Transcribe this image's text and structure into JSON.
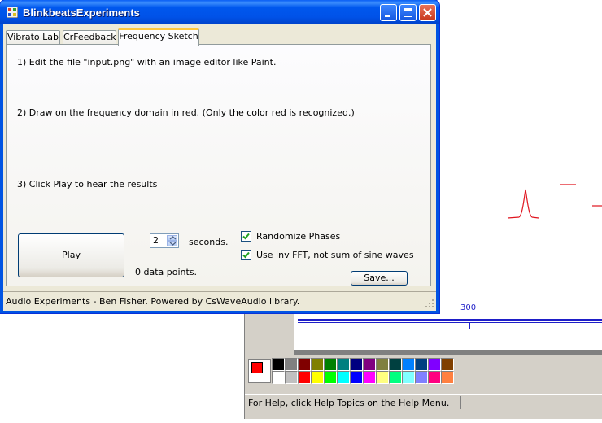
{
  "window": {
    "title": "BlinkbeatsExperiments"
  },
  "tabs": [
    {
      "label": "Vibrato Lab"
    },
    {
      "label": "CrFeedback"
    },
    {
      "label": "Frequency Sketch",
      "active": true
    }
  ],
  "instructions": {
    "step1": "1) Edit the file \"input.png\" with an image editor like Paint.",
    "step2": "2) Draw on the frequency domain in red. (Only the color red is recognized.)",
    "step3": "3) Click Play to hear the results"
  },
  "controls": {
    "play_label": "Play",
    "seconds_value": "2",
    "seconds_label": "seconds.",
    "datapoints_label": "0 data points.",
    "randomize_label": "Randomize Phases",
    "randomize_checked": true,
    "invfft_label": "Use inv FFT, not sum of sine waves",
    "invfft_checked": true,
    "save_label": "Save..."
  },
  "status": {
    "text": "Audio Experiments - Ben Fisher. Powered by CsWaveAudio library."
  },
  "paint": {
    "axis_label": "300",
    "status_text": "For Help, click Help Topics on the Help Menu.",
    "foreground_color": "#ff0000",
    "palette_top": [
      "#000000",
      "#808080",
      "#800000",
      "#808000",
      "#008000",
      "#008080",
      "#000080",
      "#800080",
      "#808040",
      "#004040",
      "#0080ff",
      "#004080",
      "#8000ff",
      "#804000"
    ],
    "palette_bottom": [
      "#ffffff",
      "#c0c0c0",
      "#ff0000",
      "#ffff00",
      "#00ff00",
      "#00ffff",
      "#0000ff",
      "#ff00ff",
      "#ffff80",
      "#00ff80",
      "#80ffff",
      "#8080ff",
      "#ff0080",
      "#ff8040"
    ]
  },
  "colors": {
    "titlebar": "#0054e3",
    "sketch": "#ff0000"
  }
}
